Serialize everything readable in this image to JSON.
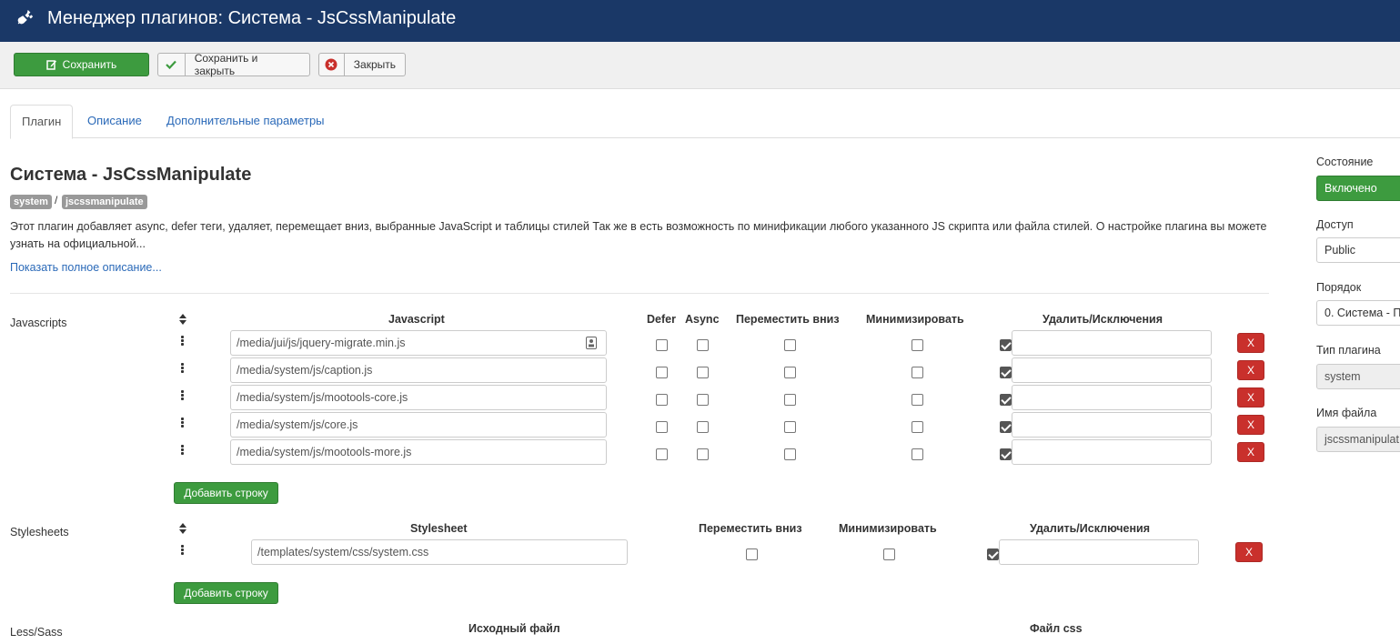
{
  "header": {
    "title": "Менеджер плагинов: Система - JsCssManipulate",
    "icon": "plug-icon"
  },
  "toolbar": {
    "save": "Сохранить",
    "save_close": "Сохранить и закрыть",
    "close": "Закрыть"
  },
  "tabs": [
    {
      "label": "Плагин",
      "active": true
    },
    {
      "label": "Описание",
      "active": false
    },
    {
      "label": "Дополнительные параметры",
      "active": false
    }
  ],
  "plugin": {
    "title": "Система - JsCssManipulate",
    "badges": [
      "system",
      "jscssmanipulate"
    ],
    "separator": "/",
    "description": "Этот плагин добавляет async, defer теги, удаляет, перемещает вниз, выбранные JavaScript и таблицы стилей Так же в есть возможность по минификации любого указанного JS скрипта или файла стилей. О настройке плагина вы можете узнать на официальной...",
    "more_link": "Показать полное описание..."
  },
  "javascripts": {
    "label": "Javascripts",
    "columns": {
      "file": "Javascript",
      "defer": "Defer",
      "async": "Async",
      "move_down": "Переместить вниз",
      "minify": "Минимизировать",
      "remove": "Удалить/Исключения"
    },
    "rows": [
      {
        "file": "/media/jui/js/jquery-migrate.min.js",
        "defer": false,
        "async": false,
        "move_down": false,
        "minify": false,
        "remove": true,
        "exceptions": ""
      },
      {
        "file": "/media/system/js/caption.js",
        "defer": false,
        "async": false,
        "move_down": false,
        "minify": false,
        "remove": true,
        "exceptions": ""
      },
      {
        "file": "/media/system/js/mootools-core.js",
        "defer": false,
        "async": false,
        "move_down": false,
        "minify": false,
        "remove": true,
        "exceptions": ""
      },
      {
        "file": "/media/system/js/core.js",
        "defer": false,
        "async": false,
        "move_down": false,
        "minify": false,
        "remove": true,
        "exceptions": ""
      },
      {
        "file": "/media/system/js/mootools-more.js",
        "defer": false,
        "async": false,
        "move_down": false,
        "minify": false,
        "remove": true,
        "exceptions": ""
      }
    ],
    "remove_button": "X",
    "add_button": "Добавить строку"
  },
  "stylesheets": {
    "label": "Stylesheets",
    "columns": {
      "file": "Stylesheet",
      "move_down": "Переместить вниз",
      "minify": "Минимизировать",
      "remove": "Удалить/Исключения"
    },
    "rows": [
      {
        "file": "/templates/system/css/system.css",
        "move_down": false,
        "minify": false,
        "remove": true,
        "exceptions": ""
      }
    ],
    "remove_button": "X",
    "add_button": "Добавить строку"
  },
  "less": {
    "label": "Less/Sass",
    "col_source": "Исходный файл",
    "col_css": "Файл css"
  },
  "sidebar": {
    "status": {
      "label": "Состояние",
      "value": "Включено"
    },
    "access": {
      "label": "Доступ",
      "value": "Public"
    },
    "order": {
      "label": "Порядок",
      "value": "0. Система - П"
    },
    "type": {
      "label": "Тип плагина",
      "value": "system"
    },
    "filename": {
      "label": "Имя файла",
      "value": "jscssmanipulat"
    }
  },
  "colors": {
    "header": "#1a3867",
    "success": "#3d9b3f",
    "danger": "#c9302c",
    "link": "#2a69b8"
  }
}
